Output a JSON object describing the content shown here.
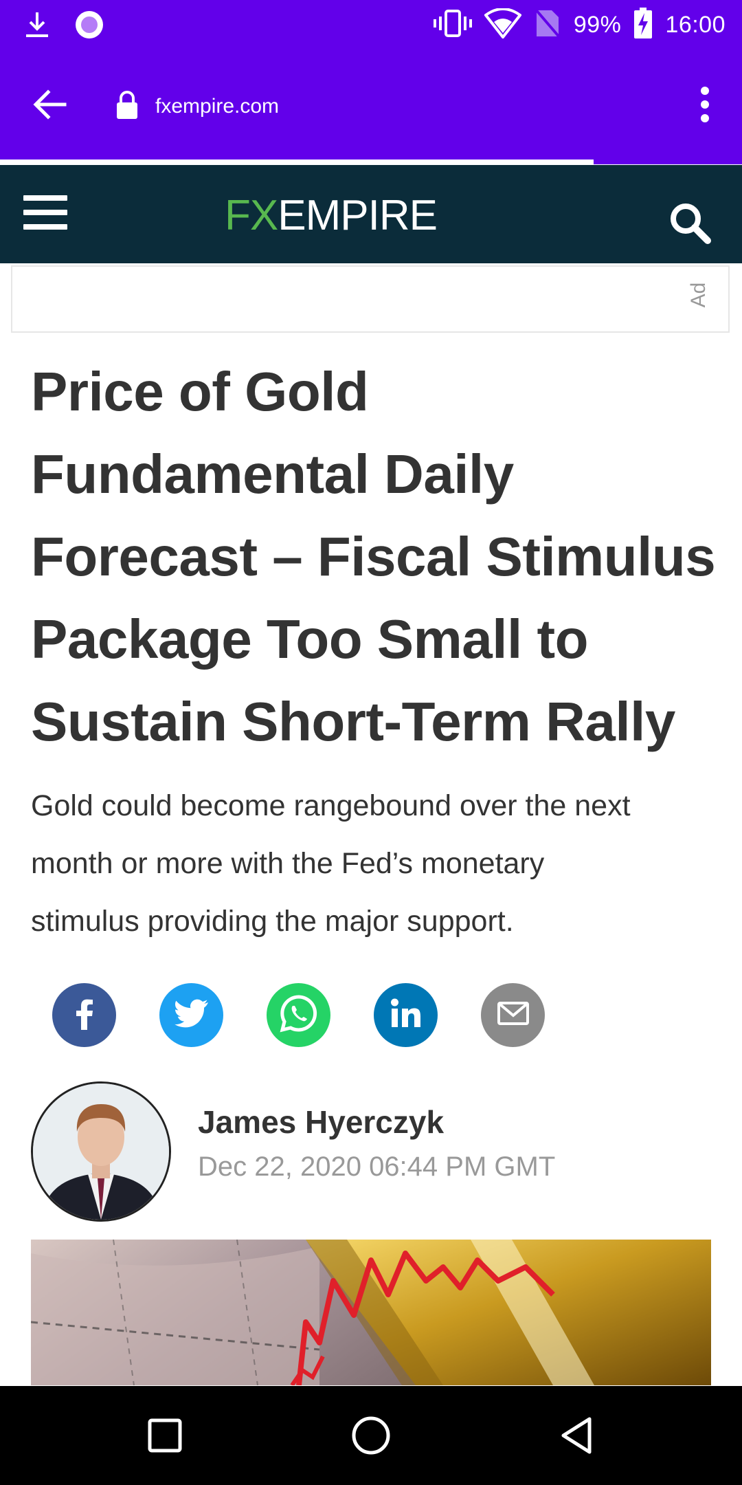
{
  "status_bar": {
    "battery": "99%",
    "time": "16:00",
    "icons": [
      "download-icon",
      "notification-dot-icon",
      "vibrate-icon",
      "wifi-icon",
      "no-sim-icon",
      "battery-charging-icon"
    ]
  },
  "browser": {
    "url": "fxempire.com",
    "load_progress": 0.8,
    "icons": [
      "back-arrow-icon",
      "lock-icon",
      "more-vert-icon"
    ]
  },
  "site_header": {
    "logo_fx": "FX",
    "logo_empire": "EMPIRE",
    "icons": [
      "hamburger-menu-icon",
      "search-icon"
    ]
  },
  "ad": {
    "label": "Ad"
  },
  "article": {
    "headline_lines": [
      "Price of Gold",
      "Fundamental Daily",
      "Forecast – Fiscal Stimulus",
      "Package Too Small to",
      "Sustain Short-Term Rally"
    ],
    "summary_lines": [
      "Gold could become rangebound over the next",
      "month or more with the Fed’s monetary",
      "stimulus providing the major support."
    ],
    "share_buttons": [
      {
        "name": "facebook",
        "icon": "facebook-icon",
        "color": "#3b5998"
      },
      {
        "name": "twitter",
        "icon": "twitter-icon",
        "color": "#1da1f2"
      },
      {
        "name": "whatsapp",
        "icon": "whatsapp-icon",
        "color": "#25d366"
      },
      {
        "name": "linkedin",
        "icon": "linkedin-icon",
        "color": "#0077b5"
      },
      {
        "name": "email",
        "icon": "email-icon",
        "color": "#8a8a8a"
      }
    ],
    "author": {
      "name": "James Hyerczyk",
      "date": "Dec 22, 2020 06:44 PM GMT"
    }
  },
  "nav_bar": {
    "icons": [
      "recents-square-icon",
      "home-circle-icon",
      "back-triangle-icon"
    ]
  },
  "colors": {
    "browser_purple": "#6200ea",
    "header_dark": "#0b2c3a",
    "logo_green": "#58b84f",
    "text_dark": "#333333",
    "text_muted": "#999999"
  }
}
